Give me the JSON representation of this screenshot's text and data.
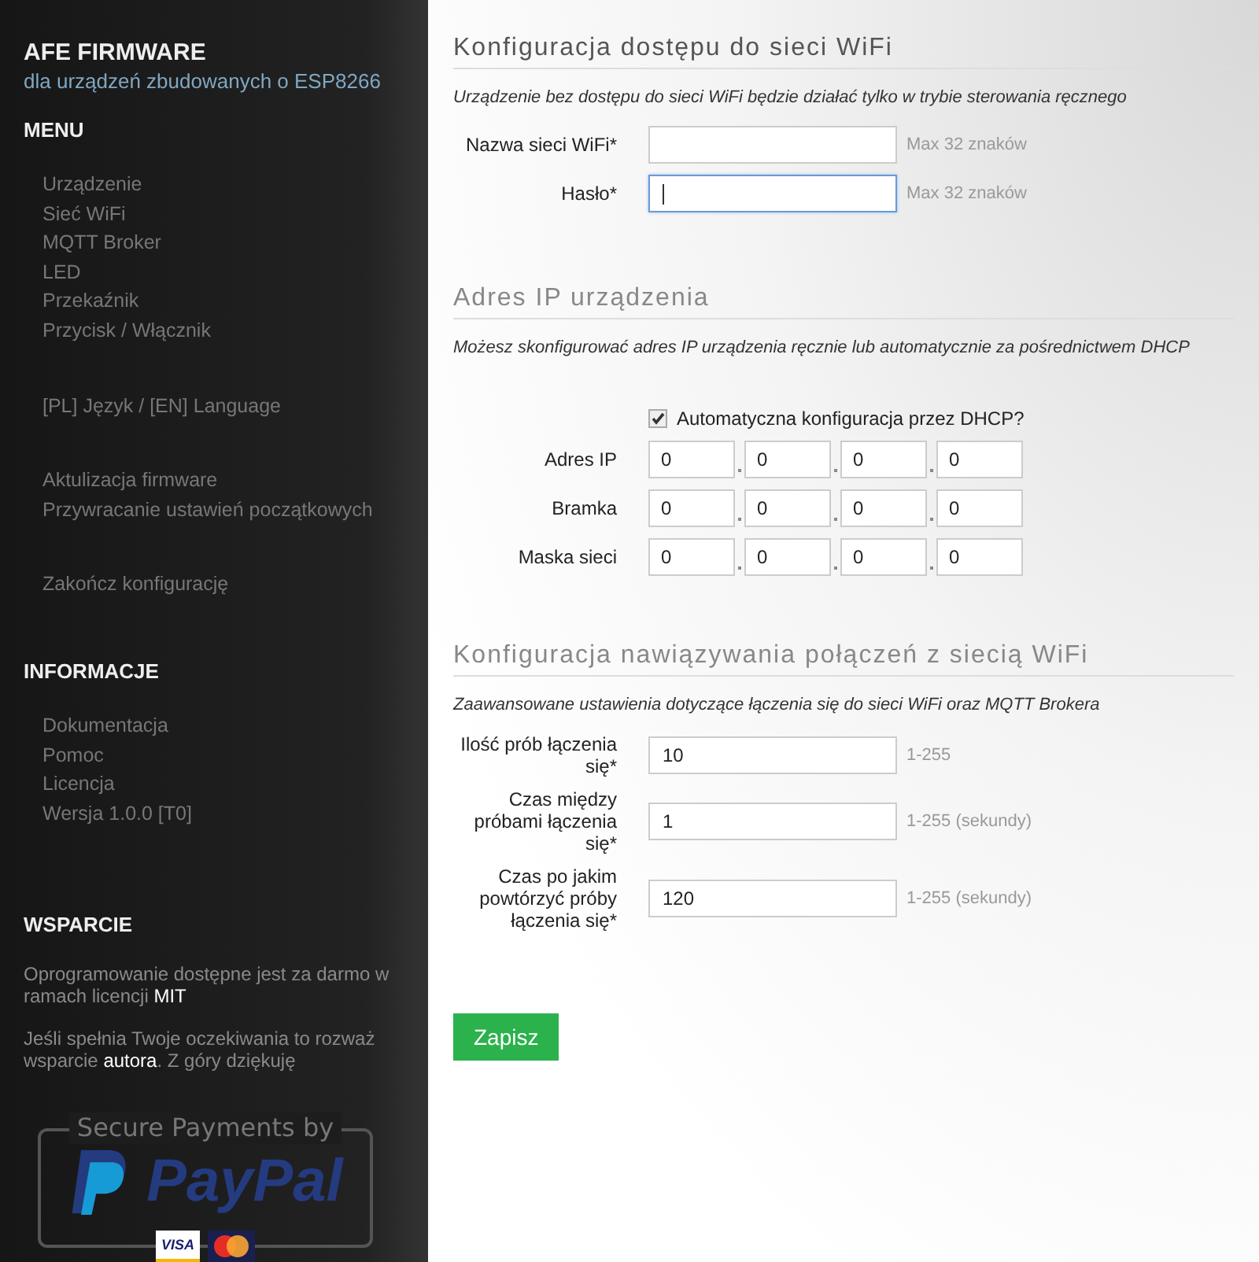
{
  "sidebar": {
    "title": "AFE FIRMWARE",
    "subtitle": "dla urządzeń zbudowanych o ESP8266",
    "sections": [
      {
        "heading": "MENU",
        "groups": [
          [
            "Urządzenie",
            "Sieć WiFi",
            "MQTT Broker",
            "LED",
            "Przekaźnik",
            "Przycisk / Włącznik"
          ],
          [
            "[PL] Język / [EN] Language"
          ],
          [
            "Aktulizacja firmware",
            "Przywracanie ustawień początkowych"
          ],
          [
            "Zakończ konfigurację"
          ]
        ]
      },
      {
        "heading": "INFORMACJE",
        "groups": [
          [
            "Dokumentacja",
            "Pomoc",
            "Licencja",
            "Wersja 1.0.0 [T0]"
          ]
        ]
      }
    ],
    "support": {
      "heading": "WSPARCIE",
      "paragraphs": [
        "Oprogramowanie dostępne jest za darmo w ramach licencji **MIT**",
        "Jeśli spełnia Twoje oczekiwania to rozważ wsparcie **autora**. Z góry dziękuję"
      ],
      "badge": {
        "caption": "Secure Payments by",
        "logo": "PayPal",
        "card": "VISA"
      }
    }
  },
  "sections": [
    {
      "title": "Konfiguracja dostępu do sieci WiFi",
      "description": "Urządzenie bez dostępu do sieci WiFi będzie działać tylko w trybie sterowania ręcznego",
      "fields": [
        {
          "kind": "text",
          "label": "Nazwa sieci WiFi*",
          "focused": false,
          "hint": "Max 32 znaków"
        },
        {
          "kind": "text",
          "label": "Hasło*",
          "focused": true,
          "hint": "Max 32 znaków"
        }
      ]
    },
    {
      "title": "Adres IP urządzenia",
      "description": "Możesz skonfigurować adres IP urządzenia ręcznie lub automatycznie za pośrednictwem DHCP",
      "fields": [
        {
          "kind": "checkbox",
          "label": "Automatyczna konfiguracja przez DHCP?",
          "checked": true
        },
        {
          "kind": "ip",
          "label": "Adres IP",
          "octets": [
            "0",
            "0",
            "0",
            "0"
          ]
        },
        {
          "kind": "ip",
          "label": "Bramka",
          "octets": [
            "0",
            "0",
            "0",
            "0"
          ]
        },
        {
          "kind": "ip",
          "label": "Maska sieci",
          "octets": [
            "0",
            "0",
            "0",
            "0"
          ]
        }
      ]
    },
    {
      "title": "Konfiguracja nawiązywania połączeń z siecią WiFi",
      "description": "Zaawansowane ustawienia dotyczące łączenia się do sieci WiFi oraz MQTT Brokera",
      "fields": [
        {
          "kind": "text",
          "label": "Ilość prób łączenia się*",
          "value": "10",
          "focused": false,
          "hint": "1-255"
        },
        {
          "kind": "text",
          "label": "Czas między próbami łączenia się*",
          "value": "1",
          "focused": false,
          "hint": "1-255 (sekundy)"
        },
        {
          "kind": "text",
          "label": "Czas po jakim powtórzyć próby łączenia się*",
          "value": "120",
          "focused": false,
          "hint": "1-255 (sekundy)"
        }
      ]
    }
  ],
  "save_button": "Zapisz"
}
